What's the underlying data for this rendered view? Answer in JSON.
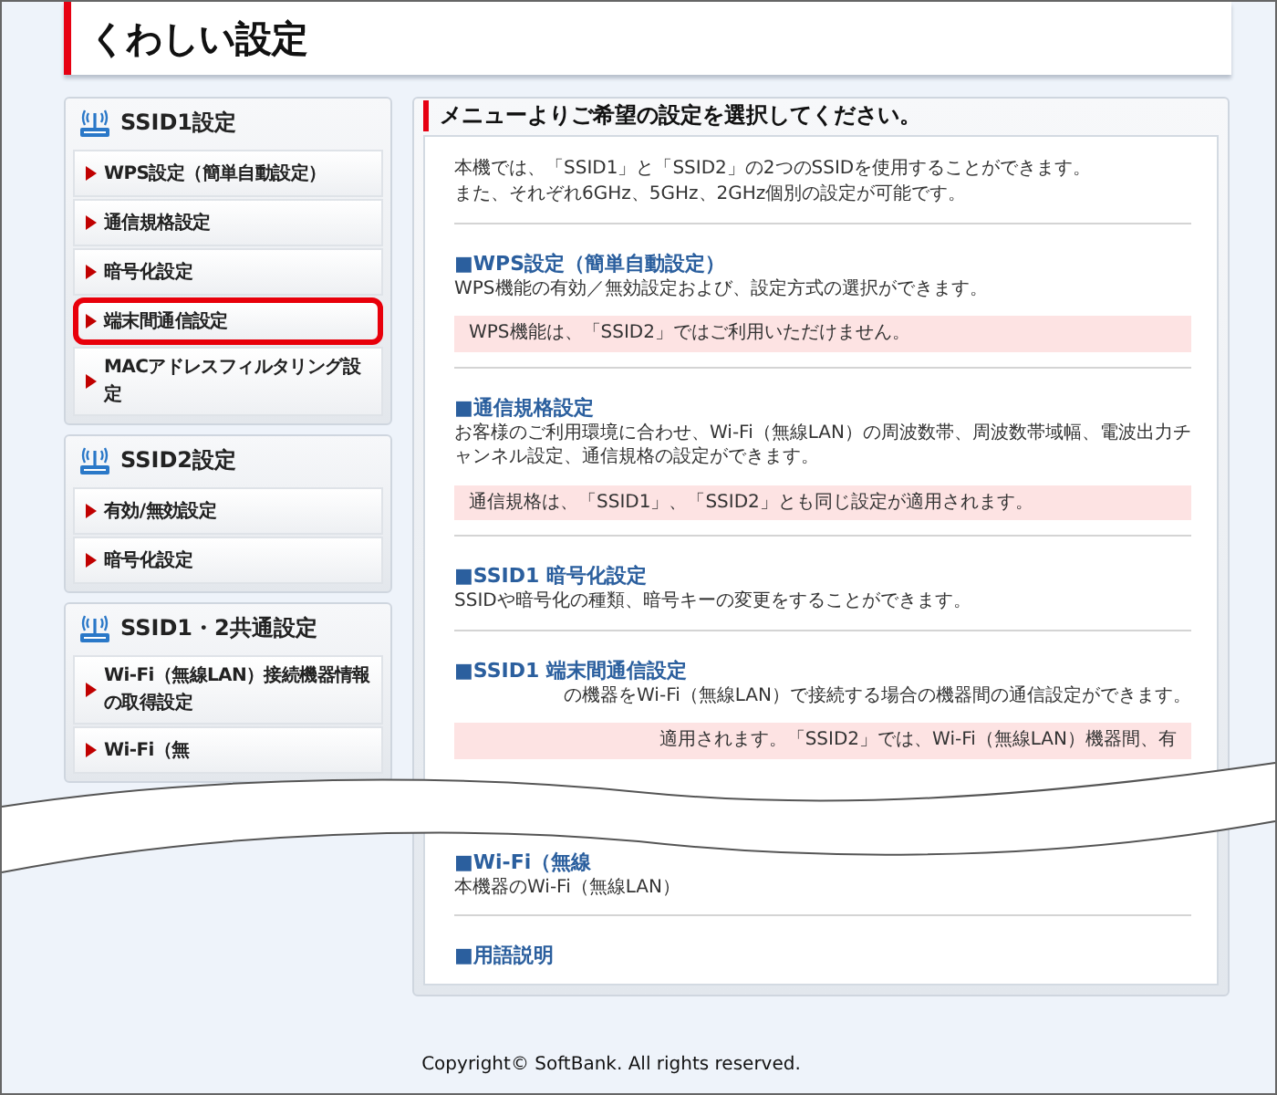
{
  "page_title": "くわしい設定",
  "sidebar": {
    "groups": [
      {
        "title": "SSID1設定",
        "items": [
          {
            "label": "WPS設定（簡単自動設定）",
            "selected": false
          },
          {
            "label": "通信規格設定",
            "selected": false
          },
          {
            "label": "暗号化設定",
            "selected": false
          },
          {
            "label": "端末間通信設定",
            "selected": true
          },
          {
            "label": "MACアドレスフィルタリング設定",
            "selected": false
          }
        ]
      },
      {
        "title": "SSID2設定",
        "items": [
          {
            "label": "有効/無効設定",
            "selected": false
          },
          {
            "label": "暗号化設定",
            "selected": false
          }
        ]
      },
      {
        "title": "SSID1・2共通設定",
        "items": [
          {
            "label": "Wi-Fi（無線LAN）接続機器情報の取得設定",
            "selected": false
          },
          {
            "label": "Wi-Fi（無",
            "selected": false
          }
        ]
      }
    ]
  },
  "main": {
    "heading": "メニューよりご希望の設定を選択してください。",
    "intro": [
      "本機では、「SSID1」と「SSID2」の2つのSSIDを使用することができます。",
      "また、それぞれ6GHz、5GHz、2GHz個別の設定が可能です。"
    ],
    "sections": [
      {
        "title": "■WPS設定（簡単自動設定）",
        "description": "WPS機能の有効／無効設定および、設定方式の選択ができます。",
        "note": "WPS機能は、「SSID2」ではご利用いただけません。"
      },
      {
        "title": "■通信規格設定",
        "description": "お客様のご利用環境に合わせ、Wi-Fi（無線LAN）の周波数帯、周波数帯域幅、電波出力チャンネル設定、通信規格の設定ができます。",
        "note": "通信規格は、「SSID1」、「SSID2」とも同じ設定が適用されます。"
      },
      {
        "title": "■SSID1 暗号化設定",
        "description": "SSIDや暗号化の種類、暗号キーの変更をすることができます。"
      },
      {
        "title": "■SSID1 端末間通信設定",
        "description": "の機器をWi-Fi（無線LAN）で接続する場合の機器間の通信設定ができます。",
        "description_cut_start": true,
        "note": "適用されます。「SSID2」では、Wi-Fi（無線LAN）機器間、有",
        "note_cut_start": true
      },
      {
        "title": "■Wi-Fi（無線",
        "description": "本機器のWi-Fi（無線LAN）"
      },
      {
        "title": "■用語説明"
      }
    ]
  },
  "footer": "Copyright© SoftBank. All rights reserved."
}
